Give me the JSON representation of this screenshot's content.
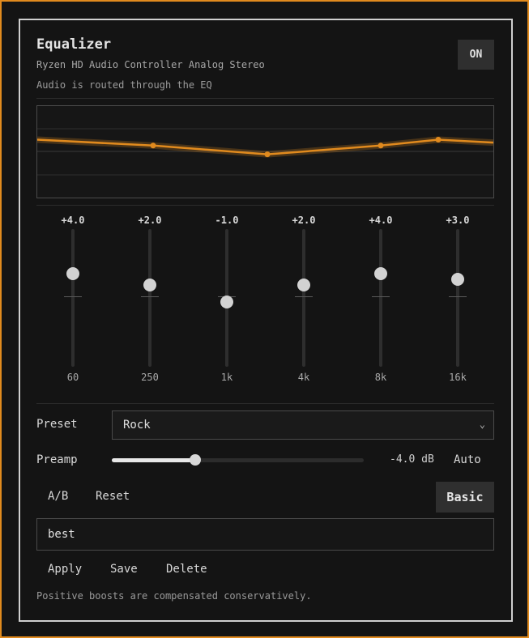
{
  "header": {
    "title": "Equalizer",
    "device": "Ryzen HD Audio Controller Analog Stereo",
    "routing_status": "Audio is routed through the EQ",
    "power_label": "ON"
  },
  "bands": [
    {
      "gain_label": "+4.0",
      "gain_db": 4.0,
      "freq_label": "60"
    },
    {
      "gain_label": "+2.0",
      "gain_db": 2.0,
      "freq_label": "250"
    },
    {
      "gain_label": "-1.0",
      "gain_db": -1.0,
      "freq_label": "1k"
    },
    {
      "gain_label": "+2.0",
      "gain_db": 2.0,
      "freq_label": "4k"
    },
    {
      "gain_label": "+4.0",
      "gain_db": 4.0,
      "freq_label": "8k"
    },
    {
      "gain_label": "+3.0",
      "gain_db": 3.0,
      "freq_label": "16k"
    }
  ],
  "preset": {
    "label": "Preset",
    "selected": "Rock"
  },
  "preamp": {
    "label": "Preamp",
    "value_label": "-4.0 dB",
    "fraction": 0.33,
    "auto_label": "Auto"
  },
  "actions": {
    "ab_label": "A/B",
    "reset_label": "Reset",
    "basic_label": "Basic"
  },
  "preset_name": {
    "value": "best"
  },
  "preset_actions": {
    "apply_label": "Apply",
    "save_label": "Save",
    "delete_label": "Delete"
  },
  "footer": {
    "note": "Positive boosts are compensated conservatively."
  },
  "colors": {
    "accent": "#e08a1e",
    "panel_border": "#cfcfcf",
    "background": "#141414"
  }
}
